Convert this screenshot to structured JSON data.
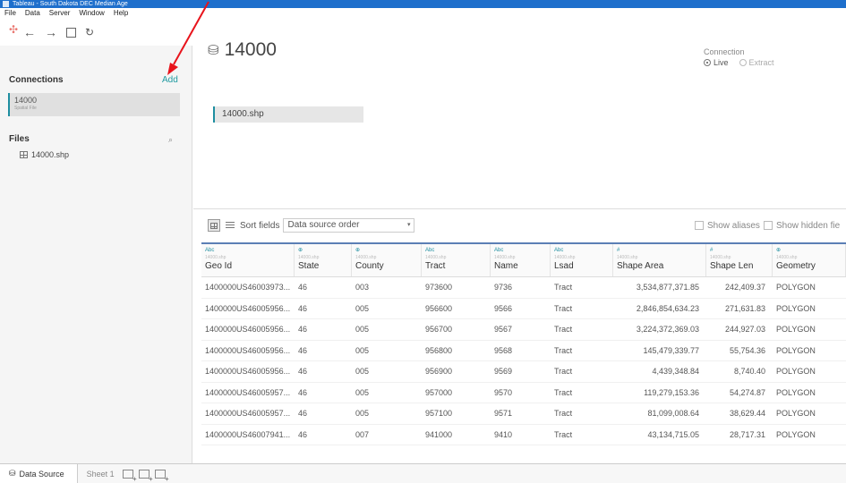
{
  "window": {
    "title": "Tableau - South Dakota DEC Median Age"
  },
  "menu": [
    "File",
    "Data",
    "Server",
    "Window",
    "Help"
  ],
  "sidebar": {
    "connections_title": "Connections",
    "add_label": "Add",
    "connection": {
      "name": "14000",
      "type": "Spatial File"
    },
    "files_title": "Files",
    "file": "14000.shp"
  },
  "main": {
    "datasource_name": "14000",
    "connection": {
      "label": "Connection",
      "live": "Live",
      "extract": "Extract"
    },
    "canvas_table": "14000.shp"
  },
  "grid_toolbar": {
    "sort_label": "Sort fields",
    "sort_value": "Data source order",
    "show_aliases": "Show aliases",
    "show_hidden": "Show hidden fie"
  },
  "columns": [
    {
      "type": "Abc",
      "source": "14000.shp",
      "name": "Geo Id"
    },
    {
      "type": "⊕",
      "source": "14000.shp",
      "name": "State"
    },
    {
      "type": "⊕",
      "source": "14000.shp",
      "name": "County"
    },
    {
      "type": "Abc",
      "source": "14000.shp",
      "name": "Tract"
    },
    {
      "type": "Abc",
      "source": "14000.shp",
      "name": "Name"
    },
    {
      "type": "Abc",
      "source": "14000.shp",
      "name": "Lsad"
    },
    {
      "type": "#",
      "source": "14000.shp",
      "name": "Shape Area"
    },
    {
      "type": "#",
      "source": "14000.shp",
      "name": "Shape Len"
    },
    {
      "type": "⊕",
      "source": "14000.shp",
      "name": "Geometry"
    }
  ],
  "rows": [
    [
      "1400000US46003973...",
      "46",
      "003",
      "973600",
      "9736",
      "Tract",
      "3,534,877,371.85",
      "242,409.37",
      "POLYGON"
    ],
    [
      "1400000US46005956...",
      "46",
      "005",
      "956600",
      "9566",
      "Tract",
      "2,846,854,634.23",
      "271,631.83",
      "POLYGON"
    ],
    [
      "1400000US46005956...",
      "46",
      "005",
      "956700",
      "9567",
      "Tract",
      "3,224,372,369.03",
      "244,927.03",
      "POLYGON"
    ],
    [
      "1400000US46005956...",
      "46",
      "005",
      "956800",
      "9568",
      "Tract",
      "145,479,339.77",
      "55,754.36",
      "POLYGON"
    ],
    [
      "1400000US46005956...",
      "46",
      "005",
      "956900",
      "9569",
      "Tract",
      "4,439,348.84",
      "8,740.40",
      "POLYGON"
    ],
    [
      "1400000US46005957...",
      "46",
      "005",
      "957000",
      "9570",
      "Tract",
      "119,279,153.36",
      "54,274.87",
      "POLYGON"
    ],
    [
      "1400000US46005957...",
      "46",
      "005",
      "957100",
      "9571",
      "Tract",
      "81,099,008.64",
      "38,629.44",
      "POLYGON"
    ],
    [
      "1400000US46007941...",
      "46",
      "007",
      "941000",
      "9410",
      "Tract",
      "43,134,715.05",
      "28,717.31",
      "POLYGON"
    ]
  ],
  "bottom": {
    "data_source_tab": "Data Source",
    "sheet_tab": "Sheet 1"
  },
  "colors": {
    "accent": "#1e8ea0",
    "titlebar": "#1e6fcc",
    "annotation": "#e8141c"
  }
}
